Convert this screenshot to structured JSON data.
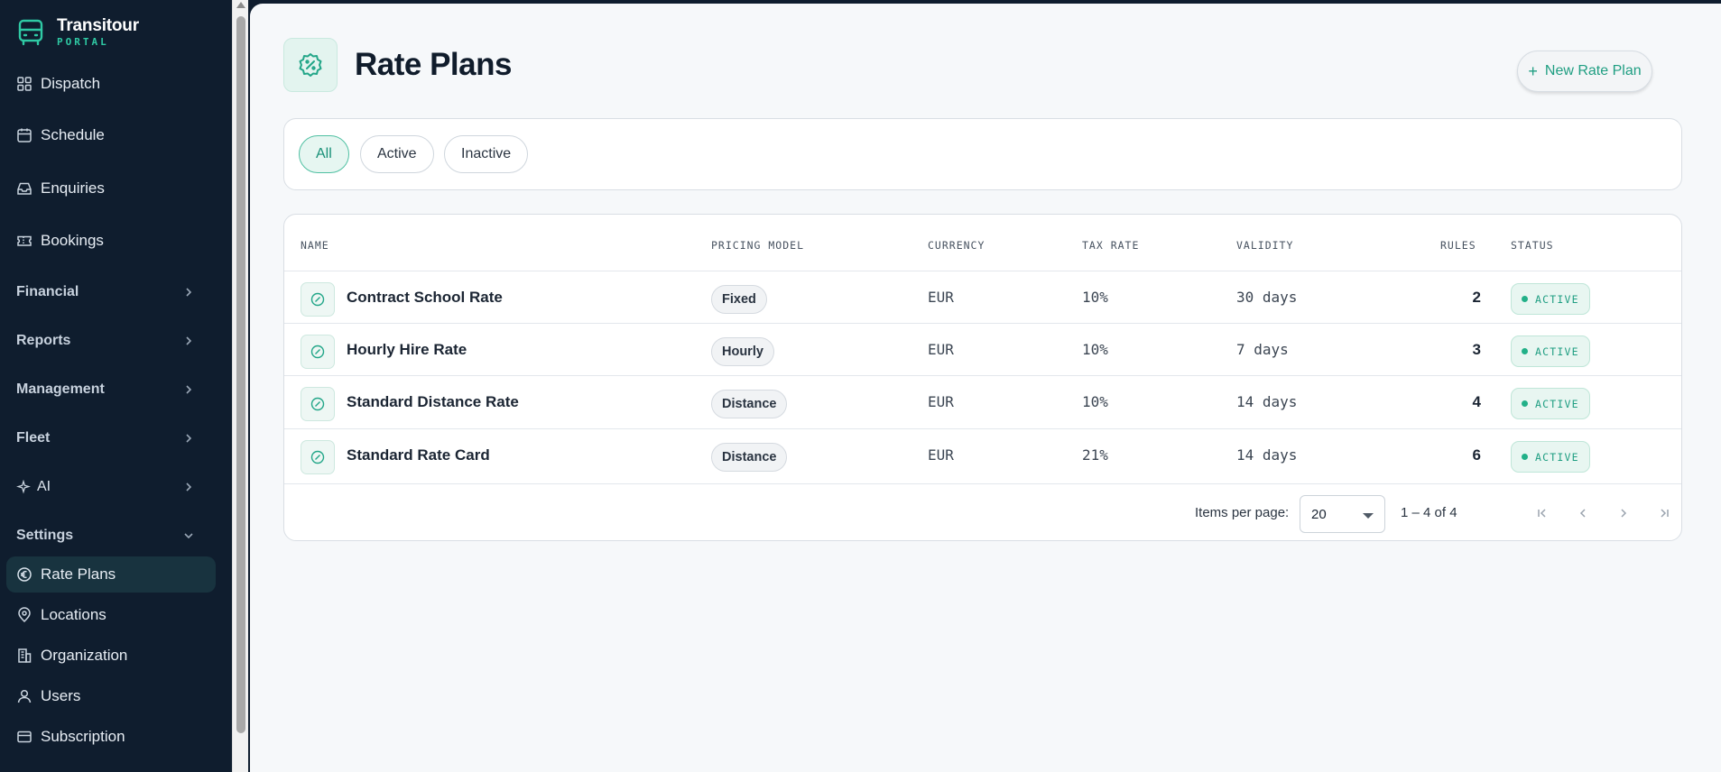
{
  "brand": {
    "title": "Transitour",
    "subtitle": "PORTAL"
  },
  "sidebar": {
    "top_items": [
      {
        "label": "Dispatch",
        "icon": "grid-icon"
      },
      {
        "label": "Schedule",
        "icon": "calendar-icon"
      },
      {
        "label": "Enquiries",
        "icon": "inbox-icon"
      },
      {
        "label": "Bookings",
        "icon": "ticket-icon"
      }
    ],
    "groups": [
      {
        "label": "Financial",
        "state": "collapsed"
      },
      {
        "label": "Reports",
        "state": "collapsed"
      },
      {
        "label": "Management",
        "state": "collapsed"
      },
      {
        "label": "Fleet",
        "state": "collapsed"
      },
      {
        "label": "AI",
        "state": "collapsed"
      },
      {
        "label": "Settings",
        "state": "expanded"
      }
    ],
    "settings_items": [
      {
        "label": "Rate Plans",
        "icon": "euro-icon",
        "active": true
      },
      {
        "label": "Locations",
        "icon": "map-pin-icon"
      },
      {
        "label": "Organization",
        "icon": "building-icon"
      },
      {
        "label": "Users",
        "icon": "user-icon"
      },
      {
        "label": "Subscription",
        "icon": "credit-card-icon"
      }
    ]
  },
  "page": {
    "title": "Rate Plans",
    "new_button": "New Rate Plan"
  },
  "filters": [
    "All",
    "Active",
    "Inactive"
  ],
  "selected_filter": "All",
  "table": {
    "headers": [
      "NAME",
      "PRICING MODEL",
      "CURRENCY",
      "TAX RATE",
      "VALIDITY",
      "RULES",
      "STATUS"
    ],
    "rows": [
      {
        "name": "Contract School Rate",
        "pricing_model": "Fixed",
        "currency": "EUR",
        "tax_rate": "10%",
        "validity": "30 days",
        "rules": "2",
        "status": "ACTIVE"
      },
      {
        "name": "Hourly Hire Rate",
        "pricing_model": "Hourly",
        "currency": "EUR",
        "tax_rate": "10%",
        "validity": "7 days",
        "rules": "3",
        "status": "ACTIVE"
      },
      {
        "name": "Standard Distance Rate",
        "pricing_model": "Distance",
        "currency": "EUR",
        "tax_rate": "10%",
        "validity": "14 days",
        "rules": "4",
        "status": "ACTIVE"
      },
      {
        "name": "Standard Rate Card",
        "pricing_model": "Distance",
        "currency": "EUR",
        "tax_rate": "21%",
        "validity": "14 days",
        "rules": "6",
        "status": "ACTIVE"
      }
    ]
  },
  "pagination": {
    "items_per_page_label": "Items per page:",
    "items_per_page": "20",
    "range": "1 – 4 of 4"
  },
  "colors": {
    "accent": "#1f9e82",
    "sidebar_bg": "#0f1d2e",
    "active_nav_bg": "#18333f"
  }
}
